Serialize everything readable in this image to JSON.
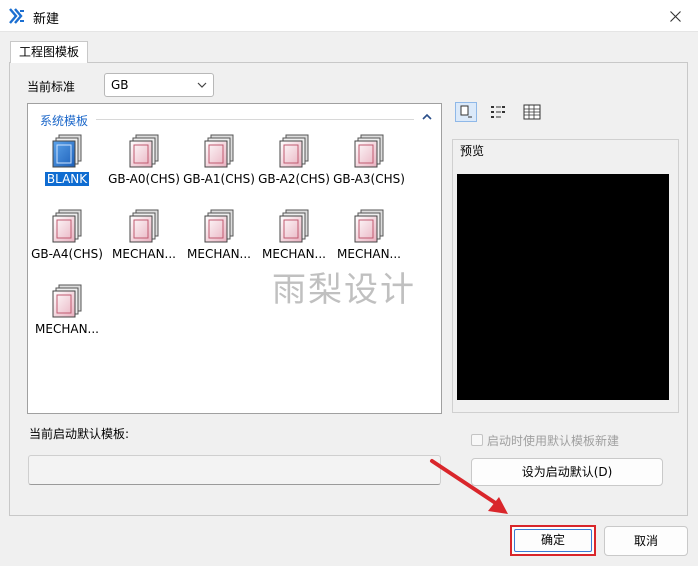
{
  "window": {
    "title": "新建"
  },
  "tabs": [
    {
      "label": "工程图模板"
    }
  ],
  "standard": {
    "label": "当前标准",
    "value": "GB"
  },
  "templates": {
    "group_label": "系统模板",
    "items": [
      {
        "label": "BLANK",
        "selected": true
      },
      {
        "label": "GB-A0(CHS)"
      },
      {
        "label": "GB-A1(CHS)"
      },
      {
        "label": "GB-A2(CHS)"
      },
      {
        "label": "GB-A3(CHS)"
      },
      {
        "label": "GB-A4(CHS)"
      },
      {
        "label": "MECHAN..."
      },
      {
        "label": "MECHAN..."
      },
      {
        "label": "MECHAN..."
      },
      {
        "label": "MECHAN..."
      },
      {
        "label": "MECHAN..."
      }
    ]
  },
  "view_modes": [
    "large-icons-view-icon",
    "list-view-icon",
    "details-view-icon"
  ],
  "preview": {
    "label": "预览"
  },
  "default_template": {
    "label": "当前启动默认模板:",
    "value": ""
  },
  "startup_checkbox": {
    "label": "启动时使用默认模板新建",
    "checked": false,
    "enabled": false
  },
  "buttons": {
    "set_default": "设为启动默认(D)",
    "ok": "确定",
    "cancel": "取消"
  },
  "watermark": "雨梨设计",
  "colors": {
    "accent": "#0f6cd1",
    "highlight_box": "#d9262b",
    "arrow": "#d9262b",
    "group_label": "#1a66c9"
  }
}
